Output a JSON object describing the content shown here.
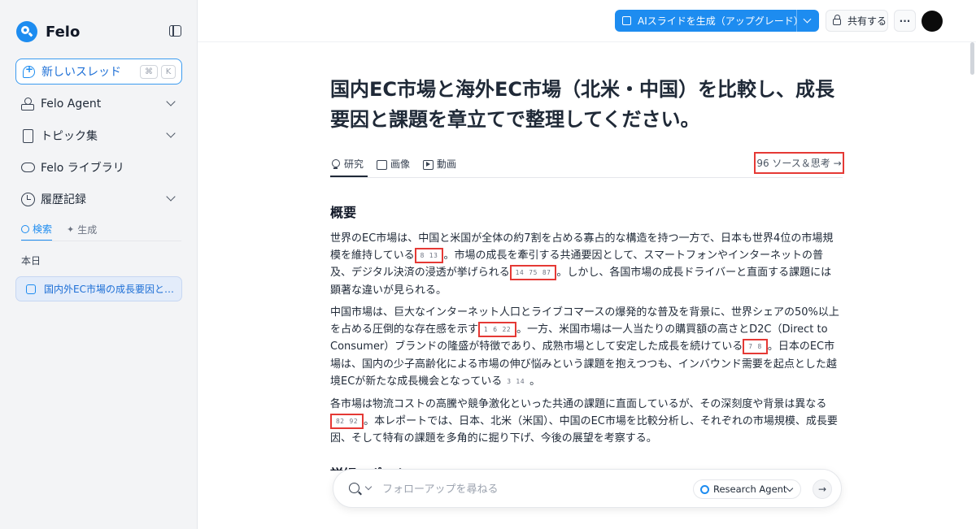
{
  "app": {
    "name": "Felo"
  },
  "sidebar": {
    "new_thread": "新しいスレッド",
    "shortcut": [
      "⌘",
      "K"
    ],
    "items": [
      {
        "label": "Felo Agent"
      },
      {
        "label": "トピック集"
      },
      {
        "label": "Felo ライブラリ"
      },
      {
        "label": "履歴記録"
      }
    ],
    "tabs": [
      "検索",
      "生成"
    ],
    "section_today": "本日",
    "history": [
      {
        "label": "国内外EC市場の成長要因と課題"
      }
    ]
  },
  "topbar": {
    "generate_label": "AIスライドを生成（アップグレード）",
    "share_label": "共有する",
    "more_label": "···"
  },
  "main": {
    "title": "国内EC市場と海外EC市場（北米・中国）を比較し、成長要因と課題を章立てで整理してください。",
    "tabs": [
      "研究",
      "画像",
      "動画"
    ],
    "sources_link": "96 ソース＆思考 →",
    "section_heading": "概要",
    "next_heading": "詳細レポート",
    "p1": {
      "a": "世界のEC市場は、中国と米国が全体の約7割を占める寡占的な構造を持つ一方で、日本も世界4位の市場規模を維持している",
      "c1": [
        "8",
        "13"
      ],
      "b": "。市場の成長を牽引する共通要因として、スマートフォンやインターネットの普及、デジタル決済の浸透が挙げられる",
      "c2": [
        "14",
        "75",
        "87"
      ],
      "c": "。しかし、各国市場の成長ドライバーと直面する課題には顕著な違いが見られる。"
    },
    "p2": {
      "a": "中国市場は、巨大なインターネット人口とライブコマースの爆発的な普及を背景に、世界シェアの50%以上を占める圧倒的な存在感を示す",
      "c1": [
        "1",
        "6",
        "22"
      ],
      "b": "。一方、米国市場は一人当たりの購買額の高さとD2C（Direct to Consumer）ブランドの隆盛が特徴であり、成熟市場として安定した成長を続けている",
      "c2": [
        "7",
        "8"
      ],
      "c": "。日本のEC市場は、国内の少子高齢化による市場の伸び悩みという課題を抱えつつも、インバウンド需要を起点とした越境ECが新たな成長機会となっている",
      "c3": [
        "3",
        "14"
      ],
      "d": "。"
    },
    "p3": {
      "a": "各市場は物流コストの高騰や競争激化といった共通の課題に直面しているが、その深刻度や背景は異なる",
      "c1": [
        "82",
        "92"
      ],
      "b": "。本レポートでは、日本、北米（米国）、中国のEC市場を比較分析し、それぞれの市場規模、成長要因、そして特有の課題を多角的に掘り下げ、今後の展望を考察する。"
    }
  },
  "followup": {
    "placeholder": "フォローアップを尋ねる",
    "agent_label": "Research Agent",
    "send_icon": "→"
  }
}
